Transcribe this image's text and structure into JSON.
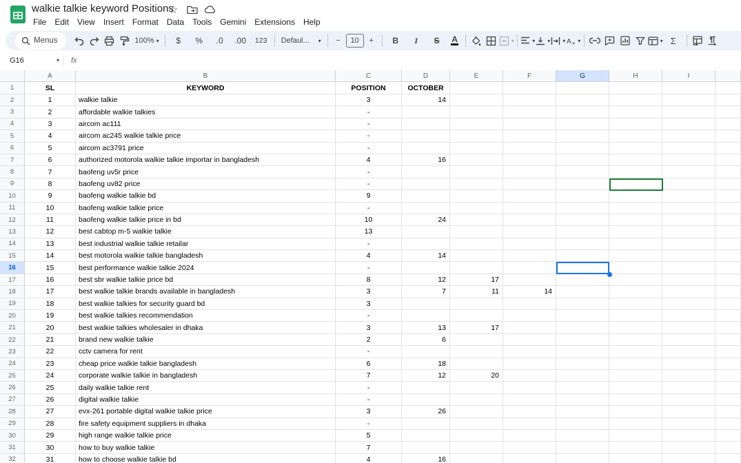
{
  "app": {
    "title": "walkie talkie keyword Positions",
    "menu_items": [
      "File",
      "Edit",
      "View",
      "Insert",
      "Format",
      "Data",
      "Tools",
      "Gemini",
      "Extensions",
      "Help"
    ]
  },
  "title_icons": {
    "star": "☆"
  },
  "toolbar": {
    "menus_label": "Menus",
    "zoom_value": "100%",
    "currency": "$",
    "percent": "%",
    "decimal_decrease": ".0",
    "decimal_increase": ".00",
    "number_format": "123",
    "font_name": "Defaul...",
    "font_size": "10",
    "minus": "−",
    "plus": "+",
    "bold": "B",
    "italic": "I",
    "strikethrough": "S",
    "text_color": "A",
    "sum": "Σ",
    "caret": "▾"
  },
  "formula_bar": {
    "cell_reference": "G16",
    "fx_label": "fx",
    "value": ""
  },
  "grid": {
    "column_headers": [
      "A",
      "B",
      "C",
      "D",
      "E",
      "F",
      "G",
      "H",
      "I"
    ],
    "selected_column": "G",
    "selected_row": 16,
    "selected_cell": "G16",
    "collaborator_cell": "H9",
    "header_row": {
      "sl": "SL",
      "keyword": "KEYWORD",
      "position": "POSITION",
      "october": "OCTOBER"
    },
    "rows": [
      {
        "n": 2,
        "sl": "1",
        "kw": "walkie talkie",
        "pos": "3",
        "oct": "14",
        "e": "",
        "f": ""
      },
      {
        "n": 3,
        "sl": "2",
        "kw": "affordable walkie talkies",
        "pos": "-",
        "oct": "",
        "e": "",
        "f": ""
      },
      {
        "n": 4,
        "sl": "3",
        "kw": "aircom ac111",
        "pos": "-",
        "oct": "",
        "e": "",
        "f": ""
      },
      {
        "n": 5,
        "sl": "4",
        "kw": "aircom ac245 walkie talkie price",
        "pos": "-",
        "oct": "",
        "e": "",
        "f": ""
      },
      {
        "n": 6,
        "sl": "5",
        "kw": "aircom ac3791 price",
        "pos": "-",
        "oct": "",
        "e": "",
        "f": ""
      },
      {
        "n": 7,
        "sl": "6",
        "kw": "authorized motorola walkie talkie importar in bangladesh",
        "pos": "4",
        "oct": "16",
        "e": "",
        "f": ""
      },
      {
        "n": 8,
        "sl": "7",
        "kw": "baofeng uv5r price",
        "pos": "-",
        "oct": "",
        "e": "",
        "f": ""
      },
      {
        "n": 9,
        "sl": "8",
        "kw": "baofeng uv82 price",
        "pos": "-",
        "oct": "",
        "e": "",
        "f": ""
      },
      {
        "n": 10,
        "sl": "9",
        "kw": "baofeng walkie talkie bd",
        "pos": "9",
        "oct": "",
        "e": "",
        "f": ""
      },
      {
        "n": 11,
        "sl": "10",
        "kw": "baofeng walkie talkie price",
        "pos": "-",
        "oct": "",
        "e": "",
        "f": ""
      },
      {
        "n": 12,
        "sl": "11",
        "kw": "baofeng walkie talkie price in bd",
        "pos": "10",
        "oct": "24",
        "e": "",
        "f": ""
      },
      {
        "n": 13,
        "sl": "12",
        "kw": "best cabtop m-5 walkie talkie",
        "pos": "13",
        "oct": "",
        "e": "",
        "f": ""
      },
      {
        "n": 14,
        "sl": "13",
        "kw": "best industrial walkie talkie retailar",
        "pos": "-",
        "oct": "",
        "e": "",
        "f": ""
      },
      {
        "n": 15,
        "sl": "14",
        "kw": "best motorola walkie talkie bangladesh",
        "pos": "4",
        "oct": "14",
        "e": "",
        "f": ""
      },
      {
        "n": 16,
        "sl": "15",
        "kw": "best performance walkie talkie 2024",
        "pos": "-",
        "oct": "",
        "e": "",
        "f": ""
      },
      {
        "n": 17,
        "sl": "16",
        "kw": "best sbr walkie talkie price bd",
        "pos": "8",
        "oct": "12",
        "e": "17",
        "f": ""
      },
      {
        "n": 18,
        "sl": "17",
        "kw": "best walkie talkie brands available in bangladesh",
        "pos": "3",
        "oct": "7",
        "e": "11",
        "f": "14"
      },
      {
        "n": 19,
        "sl": "18",
        "kw": "best walkie talkies for security guard bd",
        "pos": "3",
        "oct": "",
        "e": "",
        "f": ""
      },
      {
        "n": 20,
        "sl": "19",
        "kw": "best walkie talkies recommendation",
        "pos": "-",
        "oct": "",
        "e": "",
        "f": ""
      },
      {
        "n": 21,
        "sl": "20",
        "kw": "best walkie talkies wholesaler in dhaka",
        "pos": "3",
        "oct": "13",
        "e": "17",
        "f": ""
      },
      {
        "n": 22,
        "sl": "21",
        "kw": "brand new walkie talkie",
        "pos": "2",
        "oct": "6",
        "e": "",
        "f": ""
      },
      {
        "n": 23,
        "sl": "22",
        "kw": "cctv camera for rent",
        "pos": "-",
        "oct": "",
        "e": "",
        "f": ""
      },
      {
        "n": 24,
        "sl": "23",
        "kw": "cheap price walkie talkie bangladesh",
        "pos": "6",
        "oct": "18",
        "e": "",
        "f": ""
      },
      {
        "n": 25,
        "sl": "24",
        "kw": "corporate walkie talkie in bangladesh",
        "pos": "7",
        "oct": "12",
        "e": "20",
        "f": ""
      },
      {
        "n": 26,
        "sl": "25",
        "kw": "daily walkie talkie rent",
        "pos": "-",
        "oct": "",
        "e": "",
        "f": ""
      },
      {
        "n": 27,
        "sl": "26",
        "kw": "digital walkie talkie",
        "pos": "-",
        "oct": "",
        "e": "",
        "f": ""
      },
      {
        "n": 28,
        "sl": "27",
        "kw": "evx-261 portable digital walkie talkie price",
        "pos": "3",
        "oct": "26",
        "e": "",
        "f": ""
      },
      {
        "n": 29,
        "sl": "28",
        "kw": "fire safety equipment suppliers in dhaka",
        "pos": "-",
        "oct": "",
        "e": "",
        "f": ""
      },
      {
        "n": 30,
        "sl": "29",
        "kw": "high range walkie talkie price",
        "pos": "5",
        "oct": "",
        "e": "",
        "f": ""
      },
      {
        "n": 31,
        "sl": "30",
        "kw": "how to buy walkie talkie",
        "pos": "7",
        "oct": "",
        "e": "",
        "f": ""
      },
      {
        "n": 32,
        "sl": "31",
        "kw": "how to choose walkie talkie bd",
        "pos": "4",
        "oct": "16",
        "e": "",
        "f": ""
      }
    ]
  },
  "colors": {
    "accent_blue": "#1a73e8",
    "collaborator_green": "#188038",
    "toolbar_bg": "#edf2fa",
    "selected_header_bg": "#d3e3fd",
    "sheets_green": "#23a566"
  }
}
